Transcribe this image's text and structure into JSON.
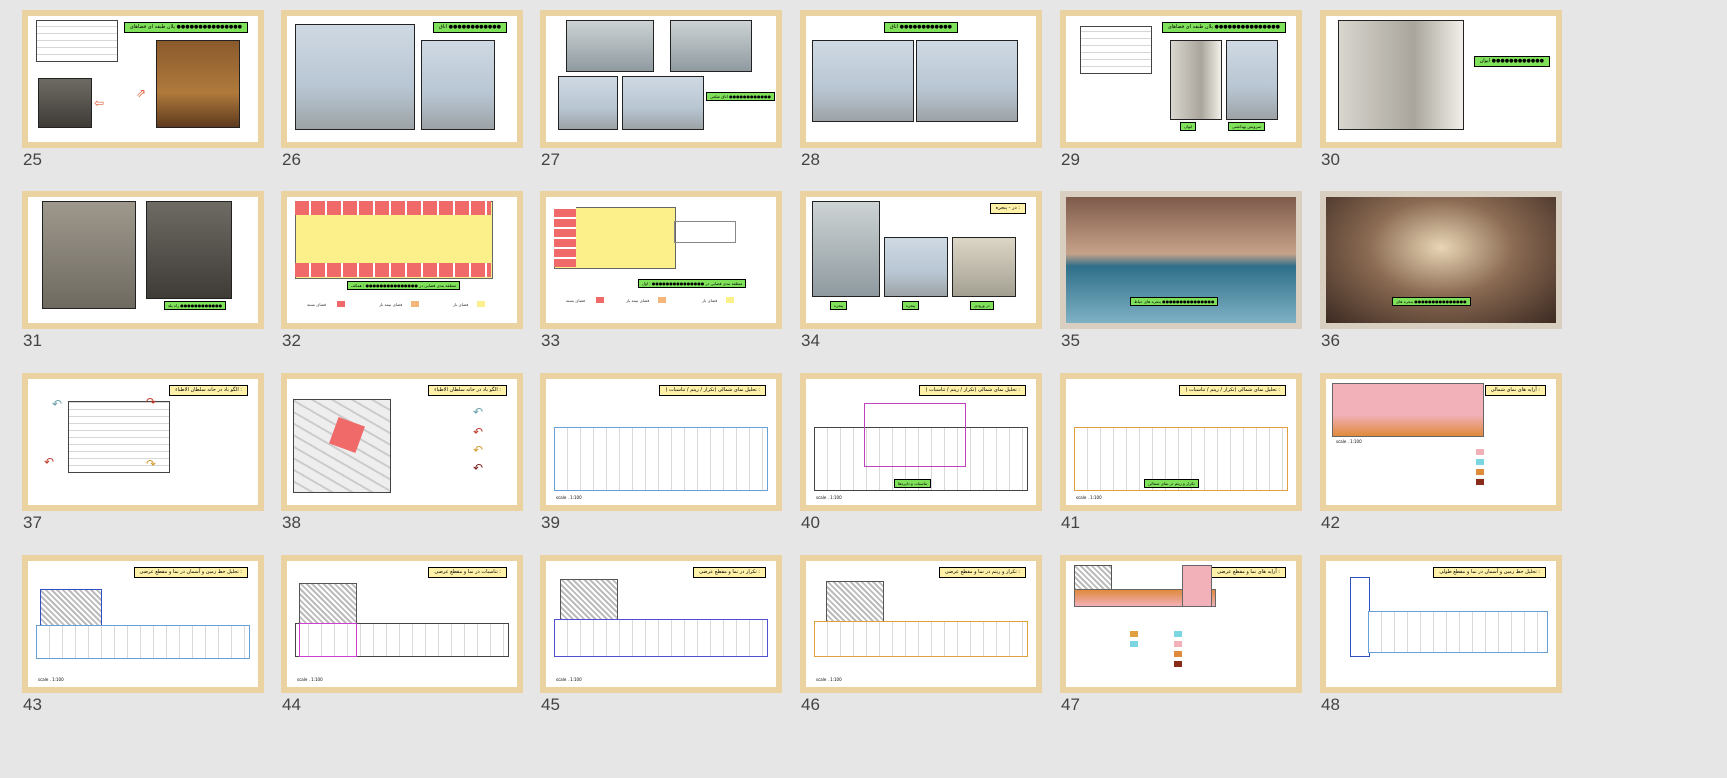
{
  "slides": [
    {
      "num": "25",
      "title": "پلان طبقه ای فضاهای ●●●●●●●●●●●●●●●",
      "title_style": "green",
      "labels": []
    },
    {
      "num": "26",
      "title": "اتاق ●●●●●●●●●●●●",
      "title_style": "green",
      "labels": []
    },
    {
      "num": "27",
      "title": "",
      "title_style": "green",
      "labels": [
        "اتاق ضلعی ●●●●●●●●●●●●"
      ]
    },
    {
      "num": "28",
      "title": "اتاق ●●●●●●●●●●●●",
      "title_style": "green",
      "labels": []
    },
    {
      "num": "29",
      "title": "پلان طبقه ای فضاهای ●●●●●●●●●●●●●●●",
      "title_style": "green",
      "labels": [
        "ایوان",
        "سرویس بهداشتی"
      ]
    },
    {
      "num": "30",
      "title": "ایوان ●●●●●●●●●●●●",
      "title_style": "green",
      "labels": []
    },
    {
      "num": "31",
      "title": "",
      "title_style": "green",
      "labels": [
        "راه پله ●●●●●●●●●●●●"
      ]
    },
    {
      "num": "32",
      "title": "",
      "title_style": "green",
      "labels": [
        "منطقه بندی فضایی در ●●●●●●●●●●●●●●● : همکف"
      ],
      "legend": [
        "فضای بسته",
        "فضای نیمه باز",
        "فضای باز"
      ]
    },
    {
      "num": "33",
      "title": "",
      "title_style": "green",
      "labels": [
        "منطقه بندی فضایی در ●●●●●●●●●●●●●●● : اول"
      ],
      "legend": [
        "فضای بسته",
        "فضای نیمه باز",
        "فضای باز"
      ]
    },
    {
      "num": "34",
      "title": "در - پنجره :",
      "title_style": "yellow",
      "labels": [
        "پنجره",
        "پنجره",
        "در ورودی"
      ]
    },
    {
      "num": "35",
      "title": "",
      "title_style": "green",
      "labels": [
        "پنجره های حیاط ●●●●●●●●●●●●●●●"
      ]
    },
    {
      "num": "36",
      "title": "",
      "title_style": "green",
      "labels": [
        "پنجره های ●●●●●●●●●●●●●●●"
      ]
    },
    {
      "num": "37",
      "title": "الگو باد در خانه سلطان الاطباء :",
      "title_style": "yellow",
      "labels": []
    },
    {
      "num": "38",
      "title": "الگو باد در خانه سلطان الاطباء :",
      "title_style": "yellow",
      "labels": []
    },
    {
      "num": "39",
      "title": "تحلیل نمای شمالی (تکرار / ریتم / تناسبات ) :",
      "title_style": "yellow",
      "labels": [],
      "scale": "scale . 1:100"
    },
    {
      "num": "40",
      "title": "تحلیل نمای شمالی (تکرار / ریتم / تناسبات ) :",
      "title_style": "yellow",
      "labels": [
        "تناسبات و دایره‌ها"
      ],
      "scale": "scale . 1:100"
    },
    {
      "num": "41",
      "title": "تحلیل نمای شمالی (تکرار / ریتم / تناسبات ) :",
      "title_style": "yellow",
      "labels": [
        "تکرار و ریتم در نمای شمالی"
      ],
      "scale": "scale . 1:100"
    },
    {
      "num": "42",
      "title": "آرایه های نمای شمالی :",
      "title_style": "yellow",
      "labels": [],
      "scale": "scale . 1:100"
    },
    {
      "num": "43",
      "title": "تحلیل خط زمین و آسمان در نما و مقطع عرضی :",
      "title_style": "yellow",
      "labels": [],
      "scale": "scale . 1:100"
    },
    {
      "num": "44",
      "title": "تناسبات در نما و مقطع عرضی :",
      "title_style": "yellow",
      "labels": [],
      "scale": "scale . 1:100"
    },
    {
      "num": "45",
      "title": "تکرار در نما و مقطع عرضی :",
      "title_style": "yellow",
      "labels": [],
      "scale": "scale . 1:100"
    },
    {
      "num": "46",
      "title": "تکرار و ریتم در نما و مقطع عرضی :",
      "title_style": "yellow",
      "labels": [],
      "scale": "scale . 1:100"
    },
    {
      "num": "47",
      "title": "آرایه های نما و مقطع عرضی :",
      "title_style": "yellow",
      "labels": []
    },
    {
      "num": "48",
      "title": "تحلیل خط زمین و آسمان در نما و مقطع طولی :",
      "title_style": "yellow",
      "labels": []
    }
  ],
  "colors": {
    "frame": "#ead3a1",
    "green_label": "#7fe05a",
    "yellow_label": "#fff2a8",
    "background": "#e6e6e6"
  }
}
